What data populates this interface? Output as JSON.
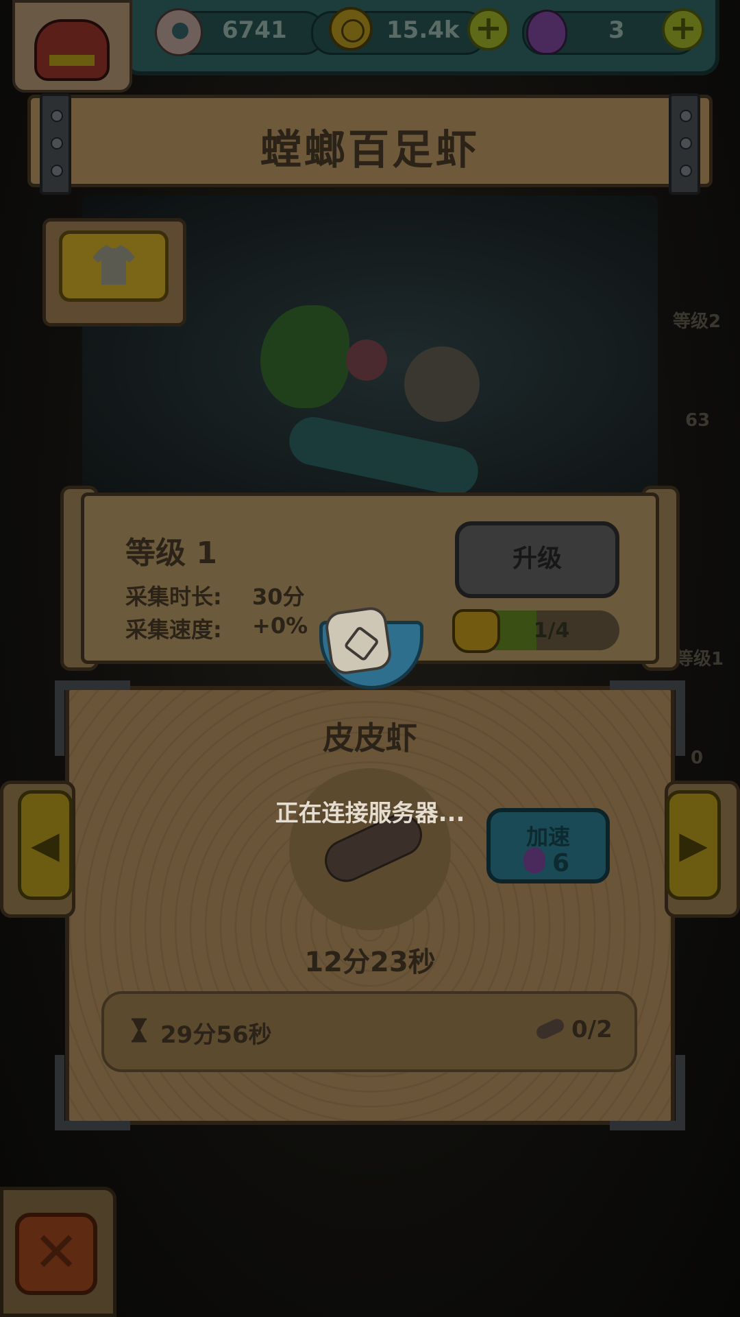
{
  "resources": {
    "eyes": {
      "icon": "eyeball-icon",
      "value": "6741"
    },
    "coins": {
      "icon": "coin-icon",
      "value": "15.4k"
    },
    "potions": {
      "icon": "potion-icon",
      "value": "3"
    }
  },
  "creature": {
    "title": "螳螂百足虾"
  },
  "level_panel": {
    "level_label": "等级 1",
    "duration_label": "采集时长:",
    "duration_value": "30分",
    "speed_label": "采集速度:",
    "speed_value": "+0%",
    "upgrade_button": "升级",
    "progress_text": "1/4",
    "progress_fraction": 0.25
  },
  "side_labels": {
    "level2": "等级2",
    "count63": "63",
    "level1": "等级1",
    "zero": "0"
  },
  "collect": {
    "item_name": "皮皮虾",
    "status": "正在连接服务器...",
    "speed_button_label": "加速",
    "speed_cost": "6",
    "timer": "12分23秒",
    "total_time": "29分56秒",
    "collected": "0/2"
  },
  "colors": {
    "teal_bar": "#1d3d3d",
    "wood": "#6b5a3c",
    "status_text": "#e4ddd0"
  }
}
